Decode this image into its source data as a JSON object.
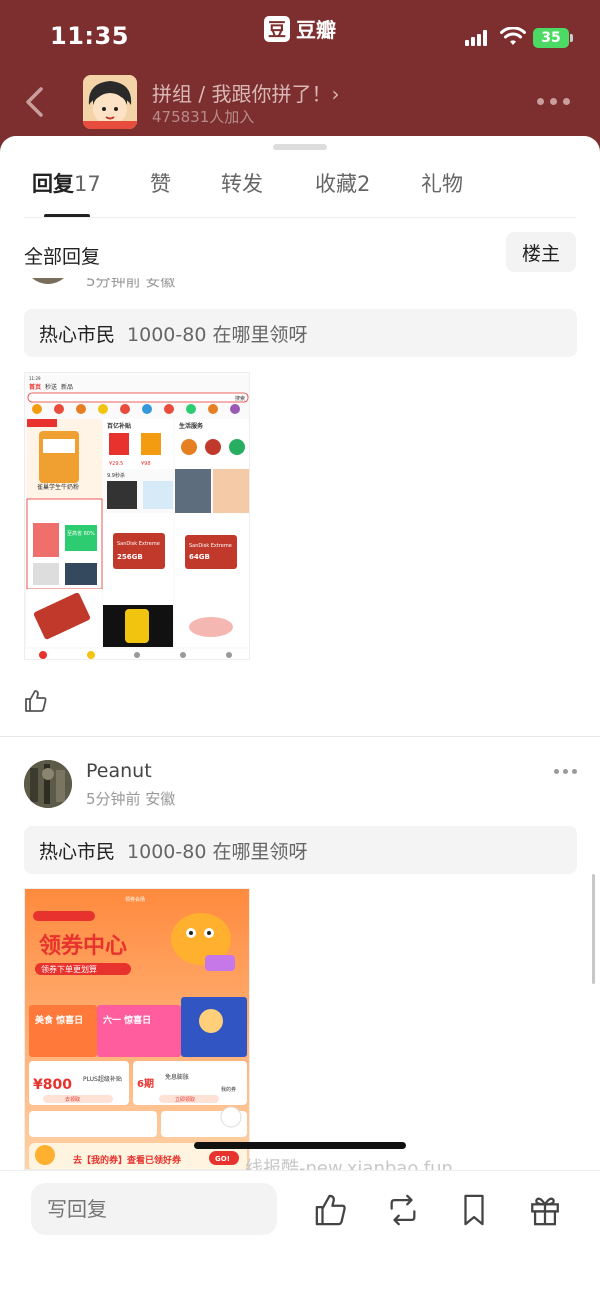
{
  "status_bar": {
    "time": "11:35",
    "brand_logo": "豆",
    "brand_name": "豆瓣",
    "battery": "35"
  },
  "group": {
    "name": "拼组 / 我跟你拼了！›",
    "members": "475831人加入"
  },
  "tabs": [
    {
      "label": "回复",
      "count": "17"
    },
    {
      "label": "赞",
      "count": ""
    },
    {
      "label": "转发",
      "count": ""
    },
    {
      "label": "收藏",
      "count": "2"
    },
    {
      "label": "礼物",
      "count": ""
    }
  ],
  "filter": {
    "label": "全部回复",
    "owner_button": "楼主"
  },
  "posts": [
    {
      "partial_meta": "5分钟前 安徽",
      "quote_author": "热心市民",
      "quote_text": "1000-80 在哪里领呀"
    },
    {
      "username": "Peanut",
      "meta": "5分钟前 安徽",
      "quote_author": "热心市民",
      "quote_text": "1000-80 在哪里领呀"
    }
  ],
  "shot1": {
    "tabs": [
      "首页",
      "秒送",
      "新品"
    ],
    "search": "搜索",
    "promo1": "雀巢学生牛奶粉",
    "promo2": "百亿补贴",
    "promo3": "生活服务",
    "price1": "¥29.5",
    "price2": "¥98",
    "product": "SanDisk Extreme",
    "capacity1": "256GB",
    "capacity2": "64GB",
    "badge": "至高省 60%",
    "deal": "9.9秒杀"
  },
  "shot2": {
    "header": "领券会场",
    "title": "领券中心",
    "subtitle": "领券下单更划算",
    "card1": "美食 惊喜日",
    "card2": "六一 惊喜日",
    "amount": "¥800",
    "plus": "PLUS超级补贴",
    "periods": "6期",
    "free": "免息膨胀",
    "claim": "去领取",
    "claim2": "立即领取",
    "mine": "我的券",
    "bottom_banner": "去【我的券】查看已领好券",
    "go": "GO!"
  },
  "watermark": "线报酷-new.xianbao.fun",
  "bottom_bar": {
    "reply_placeholder": "写回复"
  },
  "icons": [
    "back-icon",
    "more-icon",
    "like-icon",
    "share-icon",
    "bookmark-icon",
    "gift-icon"
  ],
  "colors": {
    "header_bg": "#7c2f2e",
    "battery": "#4cd964",
    "accent": "#e8322d"
  }
}
